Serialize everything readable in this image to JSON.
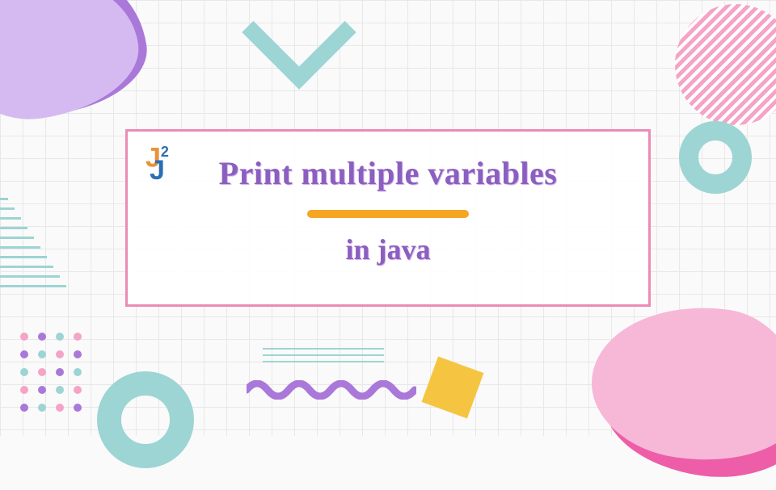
{
  "card": {
    "title": "Print multiple variables",
    "subtitle": "in java"
  },
  "logo": {
    "text": "J",
    "superscript": "2",
    "under": "J"
  },
  "colors": {
    "accent_purple": "#8b5fbf",
    "accent_pink": "#ec8bb6",
    "accent_yellow": "#f5a623",
    "accent_teal": "#9dd4d4"
  }
}
